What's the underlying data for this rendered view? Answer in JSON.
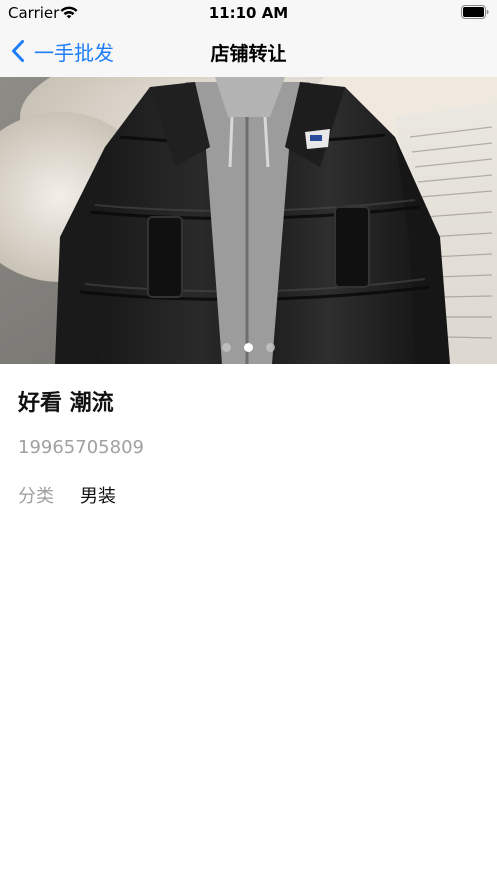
{
  "status_bar": {
    "carrier": "Carrier",
    "time": "11:10 AM"
  },
  "nav": {
    "back_label": "一手批发",
    "title": "店铺转让",
    "accent_color": "#1e7ef7"
  },
  "carousel": {
    "image_icon": "black-puffer-jacket-photo",
    "pages": 3,
    "active_page": 2
  },
  "product": {
    "title": "好看 潮流",
    "phone": "19965705809",
    "category_label": "分类",
    "category_value": "男装"
  }
}
